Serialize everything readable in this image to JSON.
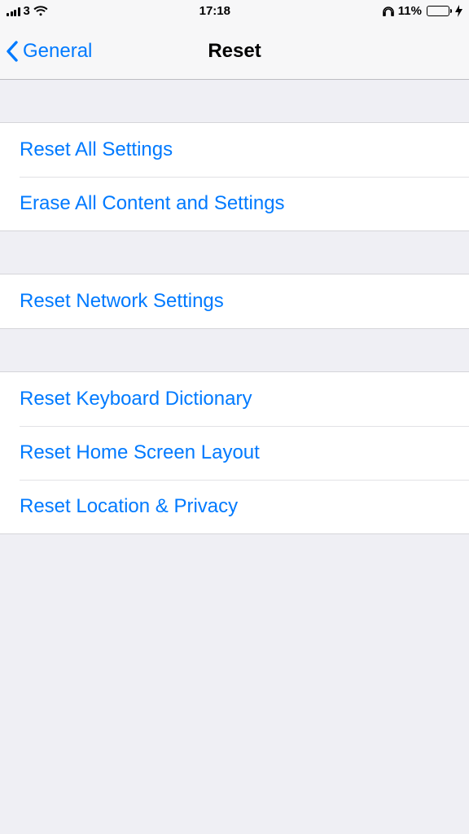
{
  "status": {
    "carrier": "3",
    "time": "17:18",
    "battery_percent": "11%"
  },
  "nav": {
    "back_label": "General",
    "title": "Reset"
  },
  "group1": [
    {
      "label": "Reset All Settings"
    },
    {
      "label": "Erase All Content and Settings"
    }
  ],
  "group2": [
    {
      "label": "Reset Network Settings"
    }
  ],
  "group3": [
    {
      "label": "Reset Keyboard Dictionary"
    },
    {
      "label": "Reset Home Screen Layout"
    },
    {
      "label": "Reset Location & Privacy"
    }
  ]
}
